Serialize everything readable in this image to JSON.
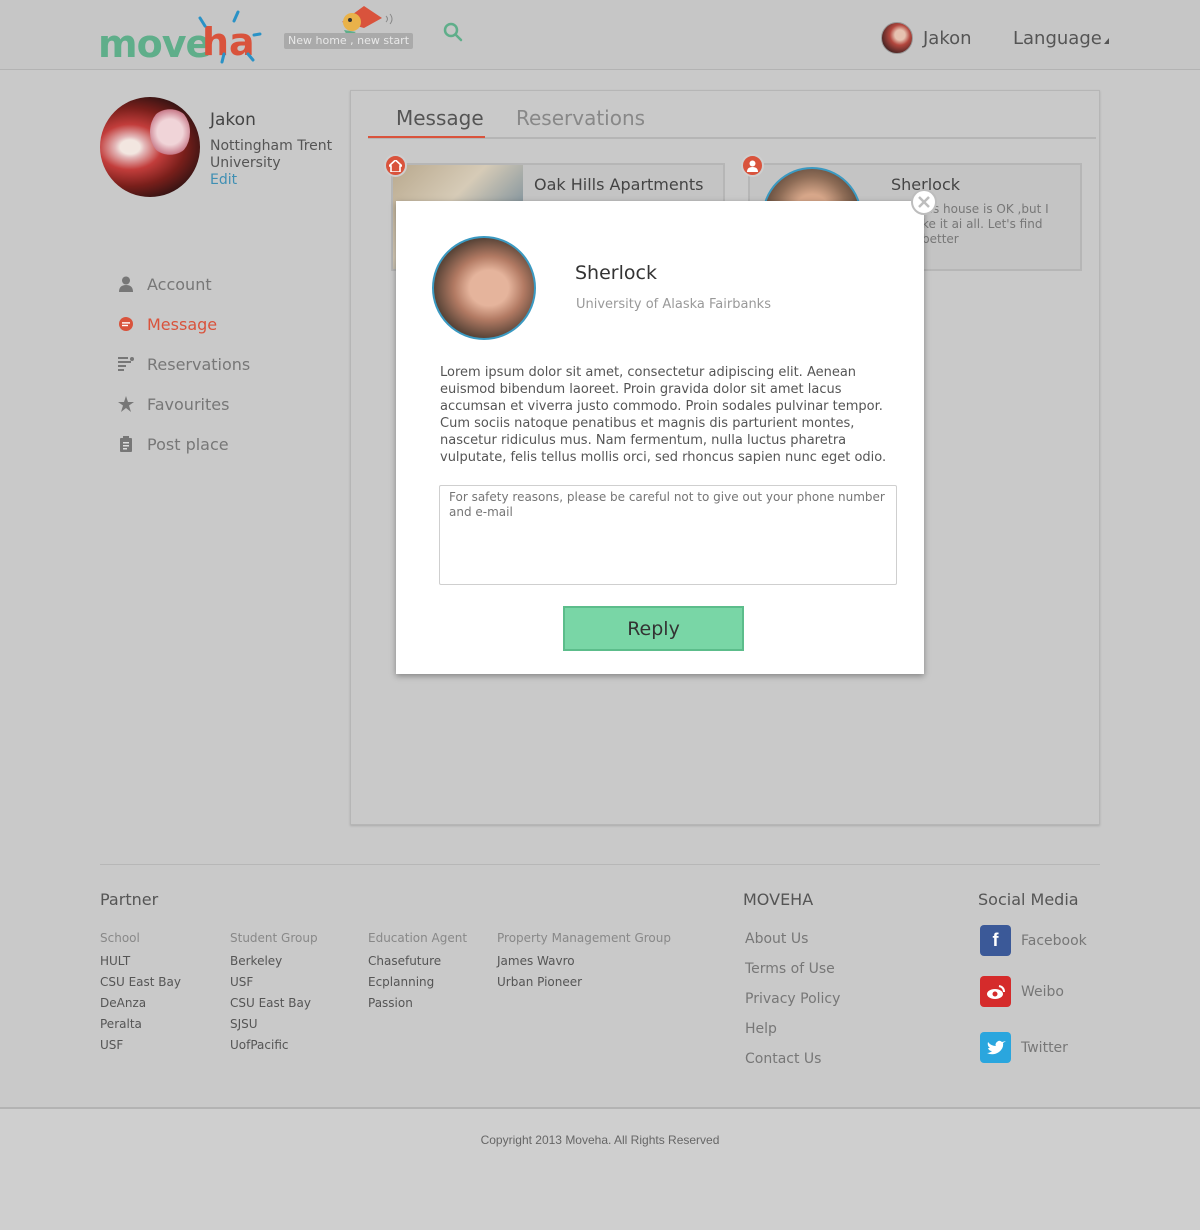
{
  "header": {
    "logo_part1": "move",
    "logo_part2": "ha",
    "tagline": "New home ,  new start",
    "user_name": "Jakon",
    "language_label": "Language"
  },
  "profile": {
    "name": "Jakon",
    "university": "Nottingham Trent University",
    "edit_label": "Edit"
  },
  "sidebar": {
    "items": [
      {
        "label": "Account",
        "icon": "user-icon"
      },
      {
        "label": "Message",
        "icon": "chat-icon"
      },
      {
        "label": "Reservations",
        "icon": "list-icon"
      },
      {
        "label": "Favourites",
        "icon": "star-icon"
      },
      {
        "label": "Post place",
        "icon": "clipboard-icon"
      }
    ]
  },
  "tabs": [
    {
      "label": "Message"
    },
    {
      "label": "Reservations"
    }
  ],
  "cards": [
    {
      "title": "Oak Hills Apartments",
      "badge_icon": "home-icon"
    },
    {
      "title": "Sherlock",
      "text": "his house is OK ,but I\nke it ai all. Let's find better",
      "badge_icon": "user-icon"
    }
  ],
  "modal": {
    "name": "Sherlock",
    "university": "University of Alaska Fairbanks",
    "body": "Lorem ipsum dolor sit amet, consectetur adipiscing elit. Aenean euismod bibendum laoreet. Proin gravida dolor sit amet lacus accumsan et viverra justo commodo. Proin sodales pulvinar tempor. Cum sociis natoque penatibus et magnis dis parturient montes, nascetur ridiculus mus. Nam fermentum, nulla luctus pharetra vulputate, felis tellus mollis orci, sed rhoncus sapien nunc eget odio.",
    "reply_placeholder": "For safety reasons, please be careful not to give out your phone number and e-mail",
    "reply_label": "Reply"
  },
  "footer": {
    "partner_heading": "Partner",
    "partner_columns": [
      {
        "heading": "School",
        "items": [
          "HULT",
          "CSU East Bay",
          "DeAnza",
          "Peralta",
          "USF"
        ]
      },
      {
        "heading": "Student Group",
        "items": [
          "Berkeley",
          "USF",
          "CSU East Bay",
          "SJSU",
          "UofPacific"
        ]
      },
      {
        "heading": "Education Agent",
        "items": [
          "Chasefuture",
          "Ecplanning",
          "Passion"
        ]
      },
      {
        "heading": "Property Management Group",
        "items": [
          "James Wavro",
          "Urban Pioneer"
        ]
      }
    ],
    "moveha_heading": "MOVEHA",
    "moveha_links": [
      "About Us",
      "Terms of Use",
      "Privacy Policy",
      "Help",
      "Contact Us"
    ],
    "social_heading": "Social Media",
    "social": [
      {
        "label": "Facebook",
        "icon": "facebook-icon",
        "color": "#3b5998"
      },
      {
        "label": "Weibo",
        "icon": "weibo-icon",
        "color": "#d52b2b"
      },
      {
        "label": "Twitter",
        "icon": "twitter-icon",
        "color": "#2aa6de"
      }
    ],
    "copyright": "Copyright 2013 Moveha.  All Rights Reserved"
  },
  "colors": {
    "accent": "#d9533c",
    "brand_green": "#5fae8a",
    "reply_button": "#79d6a6",
    "link": "#3f8fb3"
  }
}
